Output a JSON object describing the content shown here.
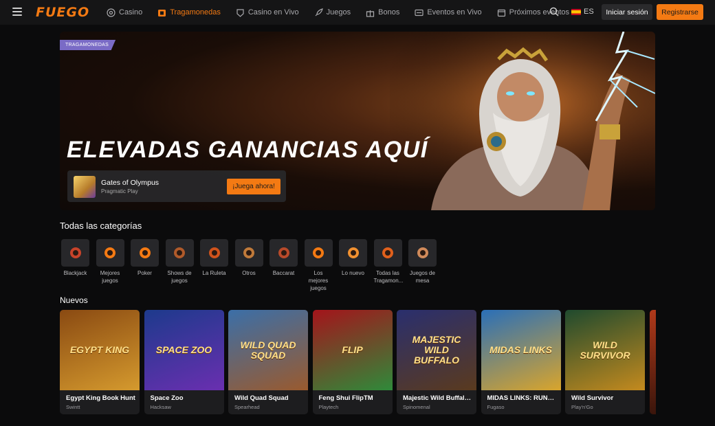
{
  "header": {
    "logo": "FUEGO",
    "nav": [
      {
        "label": "Casino",
        "icon": "casino-chip-icon",
        "active": false
      },
      {
        "label": "Tragamonedas",
        "icon": "slot-machine-icon",
        "active": true
      },
      {
        "label": "Casino en Vivo",
        "icon": "live-dealer-icon",
        "active": false
      },
      {
        "label": "Juegos",
        "icon": "rocket-icon",
        "active": false
      },
      {
        "label": "Bonos",
        "icon": "gift-icon",
        "active": false
      },
      {
        "label": "Eventos en Vivo",
        "icon": "live-events-icon",
        "active": false
      },
      {
        "label": "Próximos eventos",
        "icon": "calendar-icon",
        "active": false
      }
    ],
    "language": "ES",
    "login_label": "Iniciar sesión",
    "register_label": "Registrarse",
    "accent": "#f47a13"
  },
  "hero": {
    "tag": "TRAGAMONEDAS",
    "title": "ELEVADAS GANANCIAS AQUÍ",
    "game_name": "Gates of Olympus",
    "game_provider": "Pragmatic Play",
    "play_label": "¡Juega ahora!"
  },
  "categories": {
    "title": "Todas las categorías",
    "items": [
      {
        "label": "Blackjack",
        "icon": "blackjack-cards-icon"
      },
      {
        "label": "Mejores juegos",
        "icon": "thumbs-up-icon"
      },
      {
        "label": "Poker",
        "icon": "poker-chips-icon"
      },
      {
        "label": "Shows de juegos",
        "icon": "game-show-icon"
      },
      {
        "label": "La Ruleta",
        "icon": "roulette-icon"
      },
      {
        "label": "Otros",
        "icon": "others-icon"
      },
      {
        "label": "Baccarat",
        "icon": "baccarat-cards-icon"
      },
      {
        "label": "Los mejores juegos",
        "icon": "thumbs-up-icon"
      },
      {
        "label": "Lo nuevo",
        "icon": "new-games-icon"
      },
      {
        "label": "Todas las Tragamon...",
        "icon": "slot-bag-icon"
      },
      {
        "label": "Juegos de mesa",
        "icon": "dice-icon"
      }
    ]
  },
  "new_games": {
    "title": "Nuevos",
    "items": [
      {
        "name": "Egypt King Book Hunt",
        "provider": "Swintt",
        "art": "EGYPT KING",
        "bg": "#8a4a12",
        "bg2": "#d59a2e"
      },
      {
        "name": "Space Zoo",
        "provider": "Hacksaw",
        "art": "SPACE ZOO",
        "bg": "#1d3a8c",
        "bg2": "#6a2fb0"
      },
      {
        "name": "Wild Quad Squad",
        "provider": "Spearhead",
        "art": "WILD QUAD SQUAD",
        "bg": "#3b6fa8",
        "bg2": "#9a5a2e"
      },
      {
        "name": "Feng Shui FlipTM",
        "provider": "Playtech",
        "art": "FLIP",
        "bg": "#a4141b",
        "bg2": "#2f8a3a"
      },
      {
        "name": "Majestic Wild Buffalo Dusk Till Dawn",
        "provider": "Spinomenal",
        "art": "MAJESTIC WILD BUFFALO",
        "bg": "#2a2f6e",
        "bg2": "#5a3a1e"
      },
      {
        "name": "MIDAS LINKS: RUNNING WINS",
        "provider": "Fugaso",
        "art": "MIDAS LINKS",
        "bg": "#2a6fb8",
        "bg2": "#d9a52c"
      },
      {
        "name": "Wild Survivor",
        "provider": "Play'n'Go",
        "art": "WILD SURVIVOR",
        "bg": "#1f4a2e",
        "bg2": "#c48a1e"
      }
    ]
  }
}
